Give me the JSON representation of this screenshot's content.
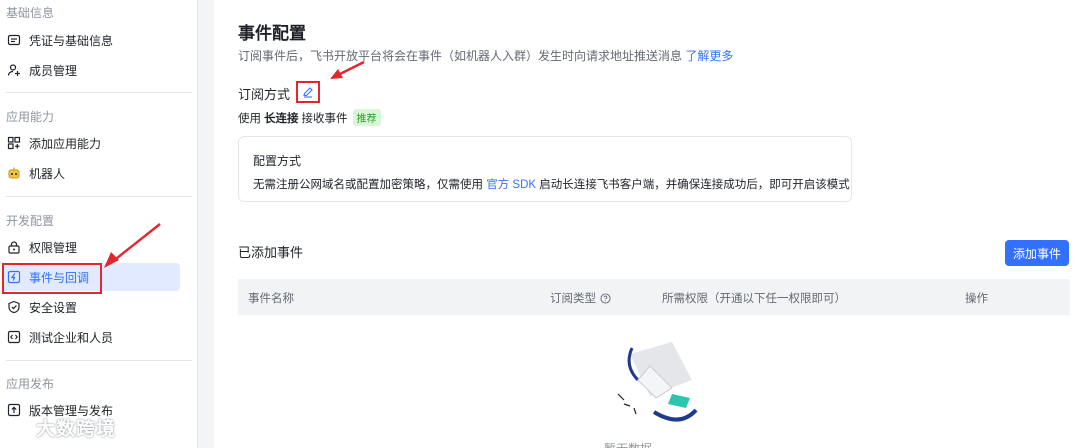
{
  "sidebar": {
    "sections": [
      {
        "title": "基础信息",
        "items": [
          {
            "label": "凭证与基础信息",
            "icon": "id-card-icon"
          },
          {
            "label": "成员管理",
            "icon": "user-add-icon"
          }
        ]
      },
      {
        "title": "应用能力",
        "items": [
          {
            "label": "添加应用能力",
            "icon": "grid-add-icon"
          },
          {
            "label": "机器人",
            "icon": "robot-icon"
          }
        ]
      },
      {
        "title": "开发配置",
        "items": [
          {
            "label": "权限管理",
            "icon": "lock-icon"
          },
          {
            "label": "事件与回调",
            "icon": "event-icon",
            "active": true
          },
          {
            "label": "安全设置",
            "icon": "shield-icon"
          },
          {
            "label": "测试企业和人员",
            "icon": "code-icon"
          }
        ]
      },
      {
        "title": "应用发布",
        "items": [
          {
            "label": "版本管理与发布",
            "icon": "upload-icon"
          }
        ]
      }
    ]
  },
  "main": {
    "title": "事件配置",
    "description": "订阅事件后，飞书开放平台将会在事件（如机器人入群）发生时向请求地址推送消息",
    "learn_more": "了解更多",
    "subscription": {
      "label": "订阅方式",
      "use_prefix": "使用",
      "mode": "长连接",
      "use_suffix": "接收事件",
      "badge": "推荐"
    },
    "config_card": {
      "title": "配置方式",
      "desc_prefix": "无需注册公网域名或配置加密策略，仅需使用",
      "sdk_link": "官方 SDK",
      "desc_suffix": "启动长连接飞书客户端，并确保连接成功后，即可开启该模式"
    },
    "events": {
      "title": "已添加事件",
      "add_button": "添加事件",
      "columns": [
        "事件名称",
        "订阅类型",
        "所需权限（开通以下任一权限即可）",
        "操作"
      ],
      "empty_text": "暂无数据"
    }
  },
  "watermark": "大数跨境",
  "colors": {
    "accent": "#3370ff",
    "annotation": "#e0282e",
    "badge_bg": "#d9f5d6",
    "badge_text": "#2ea121"
  }
}
